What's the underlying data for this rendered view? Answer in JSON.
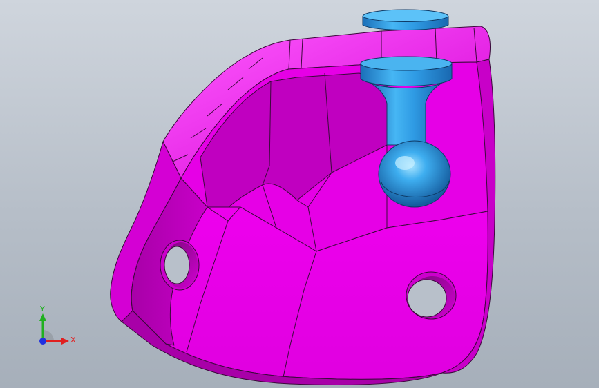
{
  "viewport": {
    "background_top": "#cfd5dd",
    "background_bottom": "#a6afba"
  },
  "model": {
    "bracket_color": "#ee00ee",
    "bracket_shadow_color": "#b400b4",
    "bracket_highlight_color": "#ff66ff",
    "ball_stud_color": "#2a9ee8",
    "ball_stud_highlight_color": "#8fd8ff",
    "edge_color": "#3a0a3a"
  },
  "triad": {
    "x_label": "X",
    "y_label": "Y",
    "x_color": "#e02020",
    "y_color": "#20b020",
    "z_color": "#2030e0"
  }
}
